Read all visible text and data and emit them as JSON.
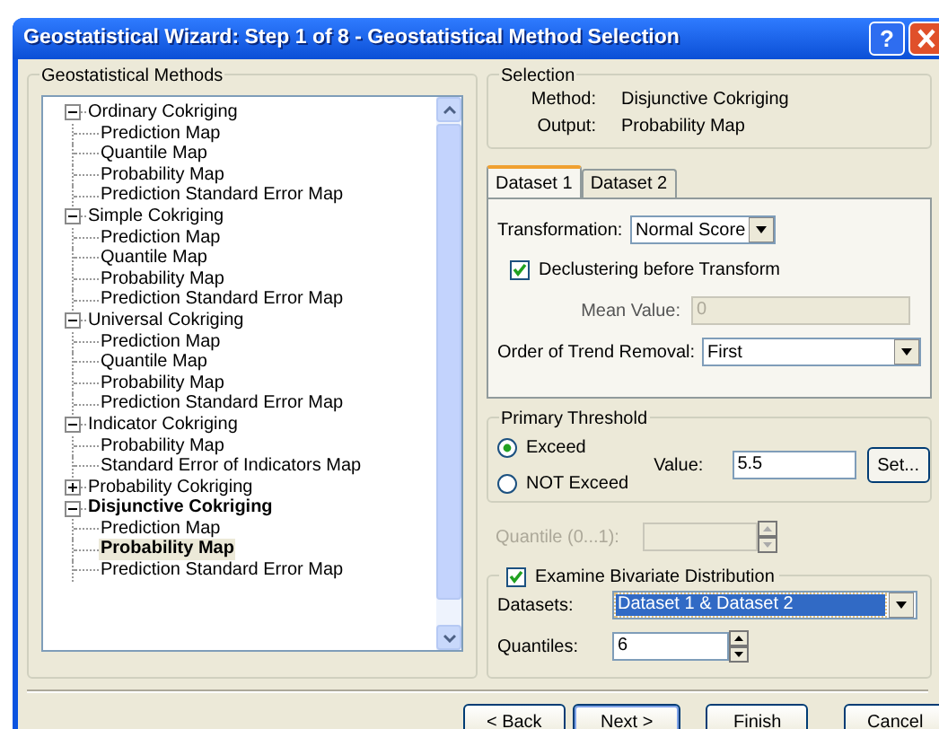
{
  "window": {
    "title": "Geostatistical Wizard: Step 1 of 8 - Geostatistical Method Selection",
    "help": "?"
  },
  "methods": {
    "legend": "Geostatistical Methods",
    "tree": [
      {
        "label": "Ordinary Cokriging",
        "expanded": true,
        "selected": false,
        "children": [
          {
            "label": "Prediction Map",
            "selected": false
          },
          {
            "label": "Quantile Map",
            "selected": false
          },
          {
            "label": "Probability Map",
            "selected": false
          },
          {
            "label": "Prediction Standard Error Map",
            "selected": false
          }
        ]
      },
      {
        "label": "Simple Cokriging",
        "expanded": true,
        "selected": false,
        "children": [
          {
            "label": "Prediction Map",
            "selected": false
          },
          {
            "label": "Quantile Map",
            "selected": false
          },
          {
            "label": "Probability Map",
            "selected": false
          },
          {
            "label": "Prediction Standard Error Map",
            "selected": false
          }
        ]
      },
      {
        "label": "Universal Cokriging",
        "expanded": true,
        "selected": false,
        "children": [
          {
            "label": "Prediction Map",
            "selected": false
          },
          {
            "label": "Quantile Map",
            "selected": false
          },
          {
            "label": "Probability Map",
            "selected": false
          },
          {
            "label": "Prediction Standard Error Map",
            "selected": false
          }
        ]
      },
      {
        "label": "Indicator Cokriging",
        "expanded": true,
        "selected": false,
        "children": [
          {
            "label": "Probability Map",
            "selected": false
          },
          {
            "label": "Standard Error of Indicators Map",
            "selected": false
          }
        ]
      },
      {
        "label": "Probability Cokriging",
        "expanded": false,
        "selected": false
      },
      {
        "label": "Disjunctive Cokriging",
        "expanded": true,
        "selected": false,
        "children": [
          {
            "label": "Prediction Map",
            "selected": false
          },
          {
            "label": "Probability Map",
            "selected": true
          },
          {
            "label": "Prediction Standard Error Map",
            "selected": false
          }
        ]
      }
    ]
  },
  "selection": {
    "legend": "Selection",
    "rows": [
      {
        "label": "Method:",
        "value": "Disjunctive Cokriging"
      },
      {
        "label": "Output:",
        "value": "Probability Map"
      }
    ]
  },
  "tabs": [
    {
      "label": "Dataset 1",
      "selected": true
    },
    {
      "label": "Dataset 2",
      "selected": false
    }
  ],
  "dataset": {
    "transformation": {
      "label": "Transformation:",
      "value": "Normal Score"
    },
    "declustering": {
      "label": "Declustering before Transform",
      "checked": true
    },
    "mean_value": {
      "label": "Mean Value:",
      "value": "0",
      "disabled": true
    },
    "trend": {
      "label": "Order of Trend Removal:",
      "value": "First"
    }
  },
  "threshold": {
    "legend": "Primary Threshold",
    "options": [
      {
        "label": "Exceed",
        "selected": true
      },
      {
        "label": "NOT Exceed",
        "selected": false
      }
    ],
    "value_label": "Value:",
    "value": "5.5",
    "set_button": "Set..."
  },
  "quantile": {
    "label": "Quantile (0...1):",
    "disabled": true
  },
  "bivariate": {
    "label": "Examine Bivariate Distribution",
    "checked": true,
    "datasets_label": "Datasets:",
    "datasets_value": "Dataset 1 & Dataset 2",
    "quantiles_label": "Quantiles:",
    "quantiles_value": "6"
  },
  "buttons": [
    "< Back",
    "Next >",
    "Finish",
    "Cancel"
  ]
}
